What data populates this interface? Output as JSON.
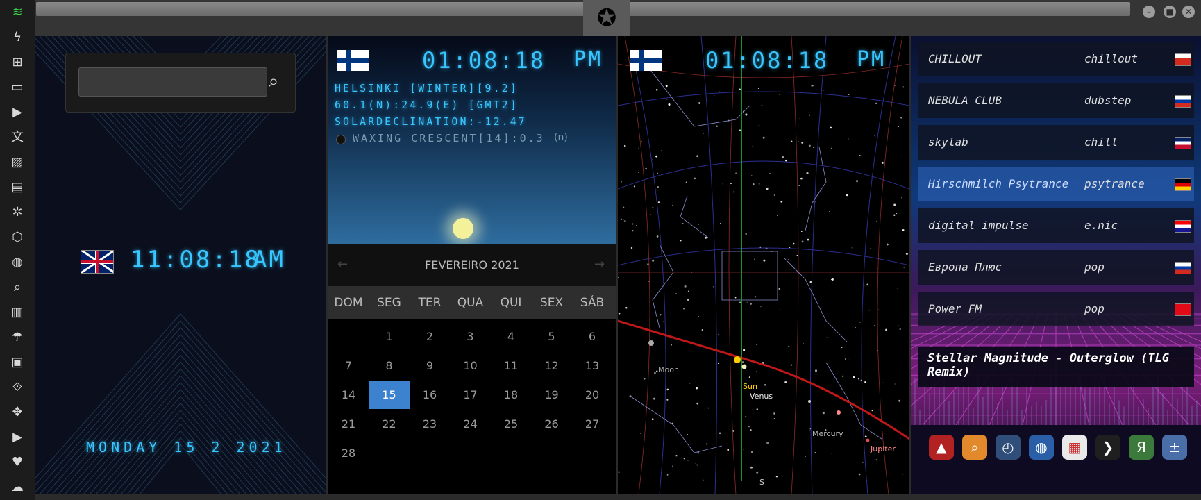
{
  "rail": {
    "icons": [
      "wifi-icon",
      "flash-icon",
      "windows-icon",
      "archive-icon",
      "play-icon",
      "translate-icon",
      "image-icon",
      "news-icon",
      "settings-icon",
      "hexagon-icon",
      "globe-icon",
      "search-icon",
      "map-icon",
      "umbrella-icon",
      "contacts-icon",
      "link-icon",
      "fullscreen-icon",
      "youtube-icon",
      "heart-icon",
      "cloud-icon"
    ],
    "glyphs": [
      "≋",
      "ϟ",
      "⊞",
      "▭",
      "▶",
      "文",
      "▨",
      "▤",
      "✲",
      "⬡",
      "◍",
      "⌕",
      "▥",
      "☂",
      "▣",
      "⟐",
      "✥",
      "▶",
      "♥",
      "☁"
    ]
  },
  "window": {
    "close": "✕",
    "maximize": "■",
    "minimize": "–",
    "logo": "✪"
  },
  "clock_panel": {
    "search": {
      "placeholder": "",
      "button": "⌕"
    },
    "time": "11:08:18",
    "ampm": "AM",
    "date": "MONDAY 15 2 2021"
  },
  "helsinki_panel": {
    "time": "01:08:18",
    "ampm": "PM",
    "city_line": "HELSINKI [WINTER][9.2]",
    "coords_line": "60.1(N):24.9(E) [GMT2]",
    "declination_line": "SOLARDECLINATION:-12.47",
    "moon_line": "WAXING CRESCENT[14]:0.3",
    "moon_suffix": "(n)"
  },
  "calendar": {
    "month": "FEVEREIRO 2021",
    "prev": "←",
    "next": "→",
    "weekdays": [
      "DOM",
      "SEG",
      "TER",
      "QUA",
      "QUI",
      "SEX",
      "SÁB"
    ],
    "weeks": [
      [
        "",
        "1",
        "2",
        "3",
        "4",
        "5",
        "6"
      ],
      [
        "7",
        "8",
        "9",
        "10",
        "11",
        "12",
        "13"
      ],
      [
        "14",
        "15",
        "16",
        "17",
        "18",
        "19",
        "20"
      ],
      [
        "21",
        "22",
        "23",
        "24",
        "25",
        "26",
        "27"
      ],
      [
        "28",
        "",
        "",
        "",
        "",
        "",
        ""
      ]
    ],
    "selected": "15"
  },
  "sky_panel": {
    "time": "01:08:18",
    "ampm": "PM",
    "labels": {
      "moon": "Moon",
      "sun": "Sun",
      "venus": "Venus",
      "mercury": "Mercury",
      "jupiter": "Jupiter",
      "south": "S"
    }
  },
  "radio": {
    "stations": [
      {
        "name": "CHILLOUT",
        "genre": "chillout",
        "flag": [
          "#ffffff",
          "#d52b1e"
        ]
      },
      {
        "name": "NEBULA CLUB",
        "genre": "dubstep",
        "flag": [
          "#ffffff",
          "#0039a6",
          "#d52b1e"
        ]
      },
      {
        "name": "skylab",
        "genre": "chill",
        "flag": [
          "#012169",
          "#ffffff",
          "#c8102e"
        ]
      },
      {
        "name": "Hirschmilch Psytrance",
        "genre": "psytrance",
        "flag": [
          "#000000",
          "#dd0000",
          "#ffce00"
        ]
      },
      {
        "name": "digital impulse",
        "genre": "e.nic",
        "flag": [
          "#ff0000",
          "#ffffff",
          "#171796"
        ]
      },
      {
        "name": "Европа Плюс",
        "genre": "pop",
        "flag": [
          "#ffffff",
          "#0039a6",
          "#d52b1e"
        ]
      },
      {
        "name": "Power FM",
        "genre": "pop",
        "flag": [
          "#e30a17",
          "#e30a17",
          "#e30a17"
        ]
      }
    ],
    "now_playing": "Stellar Magnitude - Outerglow (TLG Remix)"
  },
  "dock": {
    "icons": [
      "arrow-up-icon",
      "search-app-icon",
      "clock-app-icon",
      "globe-app-icon",
      "calendar-app-icon",
      "forward-icon",
      "yandex-icon",
      "calculator-icon"
    ],
    "glyphs": [
      "▲",
      "⌕",
      "◴",
      "◍",
      "▦",
      "❯",
      "Я",
      "±"
    ],
    "colors": [
      "#b32222",
      "#e28a2b",
      "#2f4f7a",
      "#2a5fa8",
      "#e9e9e9",
      "#1f1f1f",
      "#3b7a3b",
      "#4a6fa8"
    ]
  }
}
